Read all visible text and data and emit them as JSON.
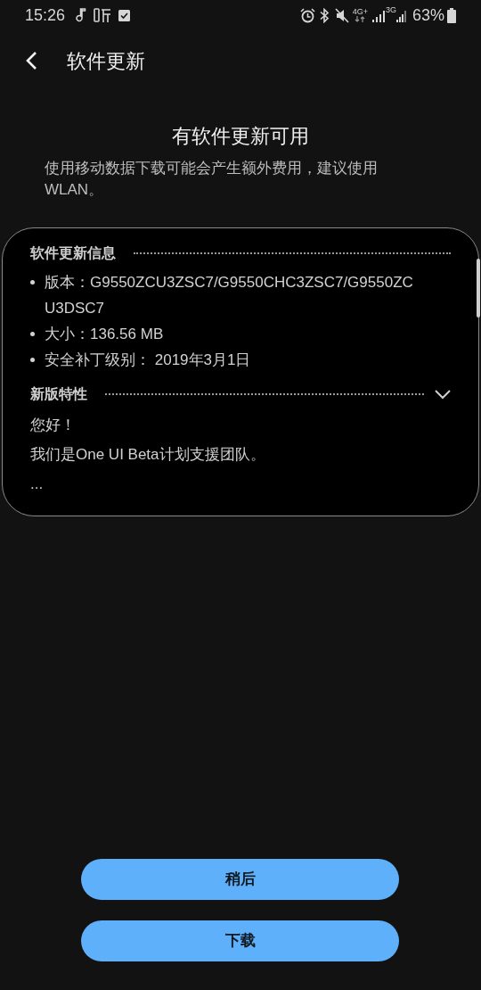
{
  "status_bar": {
    "time": "15:26",
    "network_1": "4G+",
    "network_2": "3G",
    "battery": "63%"
  },
  "header": {
    "title": "软件更新"
  },
  "notice": {
    "title": "有软件更新可用",
    "message": "使用移动数据下载可能会产生额外费用，建议使用WLAN。"
  },
  "card": {
    "sections": [
      {
        "kind": "list",
        "title": "软件更新信息",
        "items": [
          "版本：G9550ZCU3ZSC7/G9550CHC3ZSC7/G9550ZCU3DSC7",
          "大小：136.56 MB",
          "安全补丁级别： 2019年3月1日"
        ]
      },
      {
        "kind": "text",
        "title": "新版特性",
        "lines": [
          "您好！",
          "我们是One UI Beta计划支援团队。",
          "..."
        ]
      }
    ]
  },
  "buttons": [
    "稍后",
    "下载"
  ]
}
